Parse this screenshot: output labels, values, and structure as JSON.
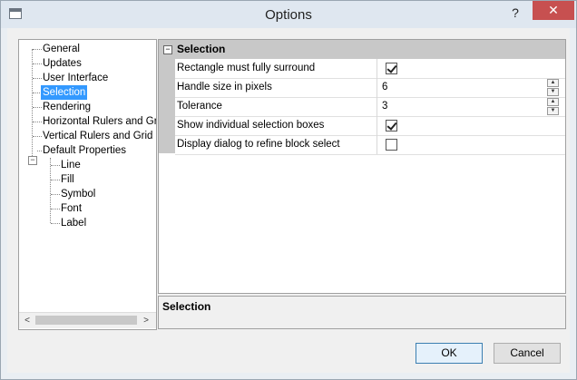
{
  "window": {
    "title": "Options",
    "help_label": "?",
    "close_label": "✕"
  },
  "tree": {
    "items": [
      "General",
      "Updates",
      "User Interface",
      "Selection",
      "Rendering",
      "Horizontal Rulers and Gri",
      "Vertical Rulers and Grid",
      "Default Properties"
    ],
    "children": [
      "Line",
      "Fill",
      "Symbol",
      "Font",
      "Label"
    ],
    "selected": "Selection",
    "scroll_left": "<",
    "scroll_right": ">"
  },
  "properties": {
    "category": "Selection",
    "rows": [
      {
        "name": "Rectangle must fully surround",
        "checked": true
      },
      {
        "name": "Handle size in pixels",
        "value": "6"
      },
      {
        "name": "Tolerance",
        "value": "3"
      },
      {
        "name": "Show individual selection boxes",
        "checked": true
      },
      {
        "name": "Display dialog to refine block select",
        "checked": false
      }
    ]
  },
  "description": {
    "title": "Selection"
  },
  "buttons": {
    "ok": "OK",
    "cancel": "Cancel"
  }
}
